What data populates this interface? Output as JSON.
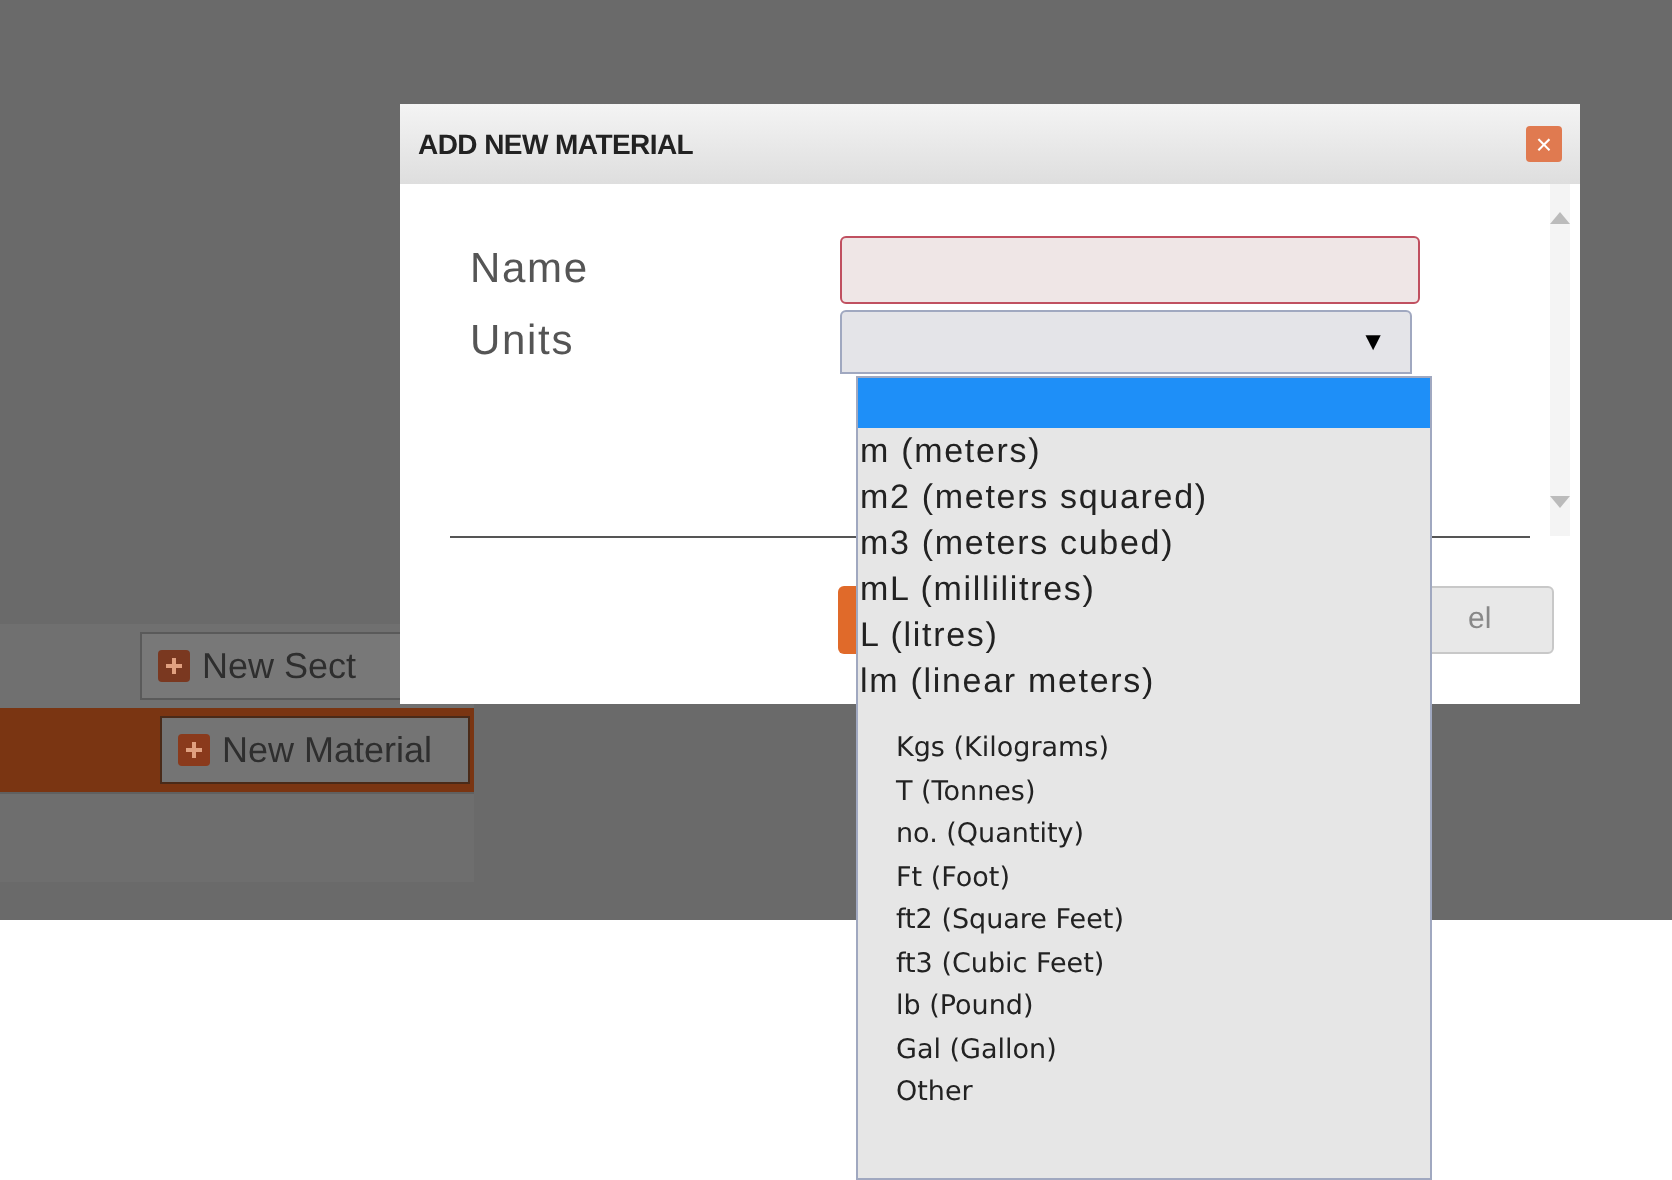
{
  "background": {
    "buttons": [
      {
        "label": "New Sect",
        "selected": false
      },
      {
        "label": "New Material",
        "selected": true
      }
    ]
  },
  "dialog": {
    "title": "ADD NEW MATERIAL",
    "close": "×",
    "fields": [
      {
        "label": "Name",
        "kind": "text",
        "invalid": true
      },
      {
        "label": "Units",
        "kind": "select",
        "caret": "▼"
      }
    ],
    "buttons": [
      {
        "kind": "primary"
      },
      {
        "kind": "secondary",
        "label": "el"
      }
    ]
  },
  "dropdown": {
    "options": [
      {
        "selected": true,
        "kind": "plain"
      },
      {
        "label": "m (meters)",
        "selected": false,
        "kind": "plain"
      },
      {
        "label": "m2 (meters squared)",
        "selected": false,
        "kind": "plain"
      },
      {
        "label": "m3 (meters cubed)",
        "selected": false,
        "kind": "plain"
      },
      {
        "label": "mL (millilitres)",
        "selected": false,
        "kind": "plain"
      },
      {
        "label": "L (litres)",
        "selected": false,
        "kind": "plain"
      },
      {
        "label": "lm (linear meters)",
        "selected": false,
        "kind": "plain"
      },
      {
        "label": "Kgs (Kilograms)",
        "selected": false,
        "kind": "extra"
      },
      {
        "label": "T (Tonnes)",
        "selected": false,
        "kind": "extra"
      },
      {
        "label": "no. (Quantity)",
        "selected": false,
        "kind": "extra"
      },
      {
        "label": "Ft (Foot)",
        "selected": false,
        "kind": "extra"
      },
      {
        "label": "ft2 (Square Feet)",
        "selected": false,
        "kind": "extra"
      },
      {
        "label": "ft3 (Cubic Feet)",
        "selected": false,
        "kind": "extra"
      },
      {
        "label": "lb (Pound)",
        "selected": false,
        "kind": "extra"
      },
      {
        "label": "Gal (Gallon)",
        "selected": false,
        "kind": "extra"
      },
      {
        "label": "Other",
        "selected": false,
        "kind": "extra"
      }
    ]
  }
}
